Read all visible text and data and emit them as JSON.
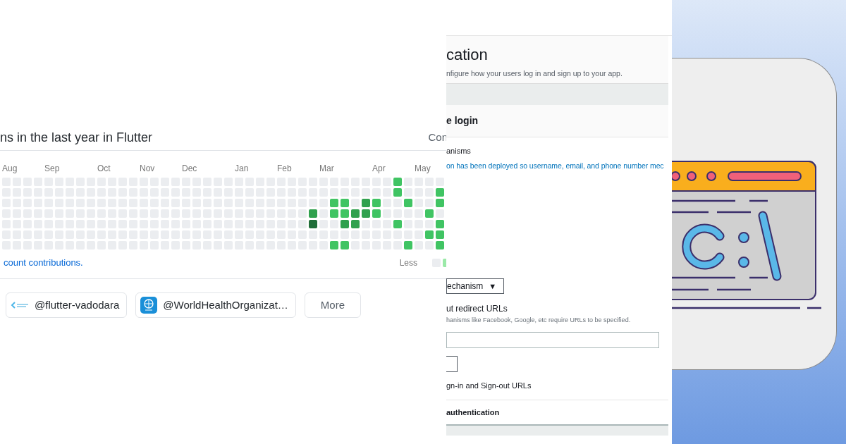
{
  "contributions": {
    "title": "ns in the last year in Flutter",
    "settings_button": "Con",
    "months": [
      "Aug",
      "Sep",
      "Oct",
      "Nov",
      "Dec",
      "Jan",
      "Feb",
      "Mar",
      "Apr",
      "May"
    ],
    "rows": [
      {
        "cells": [
          {
            "color": "#ebedf0"
          },
          {
            "color": "#ebedf0"
          },
          {
            "color": "#ebedf0"
          },
          {
            "color": "#ebedf0"
          },
          {
            "color": "#ebedf0"
          },
          {
            "color": "#ebedf0"
          },
          {
            "color": "#ebedf0"
          },
          {
            "color": "#ebedf0"
          },
          {
            "color": "#ebedf0"
          },
          {
            "color": "#ebedf0"
          },
          {
            "color": "#ebedf0"
          },
          {
            "color": "#ebedf0"
          },
          {
            "color": "#ebedf0"
          },
          {
            "color": "#ebedf0"
          },
          {
            "color": "#ebedf0"
          },
          {
            "color": "#ebedf0"
          },
          {
            "color": "#ebedf0"
          },
          {
            "color": "#ebedf0"
          },
          {
            "color": "#ebedf0"
          },
          {
            "color": "#ebedf0"
          },
          {
            "color": "#ebedf0"
          },
          {
            "color": "#ebedf0"
          },
          {
            "color": "#ebedf0"
          },
          {
            "color": "#ebedf0"
          },
          {
            "color": "#ebedf0"
          },
          {
            "color": "#ebedf0"
          },
          {
            "color": "#ebedf0"
          },
          {
            "color": "#ebedf0"
          },
          {
            "color": "#ebedf0"
          },
          {
            "color": "#ebedf0"
          },
          {
            "color": "#ebedf0"
          },
          {
            "color": "#ebedf0"
          },
          {
            "color": "#ebedf0"
          },
          {
            "color": "#ebedf0"
          },
          {
            "color": "#ebedf0"
          },
          {
            "color": "#ebedf0"
          },
          {
            "color": "#ebedf0"
          },
          {
            "color": "#40c463"
          },
          {
            "color": "#ebedf0"
          },
          {
            "color": "#ebedf0"
          },
          {
            "color": "#ebedf0"
          },
          {
            "color": "#ebedf0"
          }
        ]
      },
      {
        "cells": [
          {
            "color": "#ebedf0"
          },
          {
            "color": "#ebedf0"
          },
          {
            "color": "#ebedf0"
          },
          {
            "color": "#ebedf0"
          },
          {
            "color": "#ebedf0"
          },
          {
            "color": "#ebedf0"
          },
          {
            "color": "#ebedf0"
          },
          {
            "color": "#ebedf0"
          },
          {
            "color": "#ebedf0"
          },
          {
            "color": "#ebedf0"
          },
          {
            "color": "#ebedf0"
          },
          {
            "color": "#ebedf0"
          },
          {
            "color": "#ebedf0"
          },
          {
            "color": "#ebedf0"
          },
          {
            "color": "#ebedf0"
          },
          {
            "color": "#ebedf0"
          },
          {
            "color": "#ebedf0"
          },
          {
            "color": "#ebedf0"
          },
          {
            "color": "#ebedf0"
          },
          {
            "color": "#ebedf0"
          },
          {
            "color": "#ebedf0"
          },
          {
            "color": "#ebedf0"
          },
          {
            "color": "#ebedf0"
          },
          {
            "color": "#ebedf0"
          },
          {
            "color": "#ebedf0"
          },
          {
            "color": "#ebedf0"
          },
          {
            "color": "#ebedf0"
          },
          {
            "color": "#ebedf0"
          },
          {
            "color": "#ebedf0"
          },
          {
            "color": "#ebedf0"
          },
          {
            "color": "#ebedf0"
          },
          {
            "color": "#ebedf0"
          },
          {
            "color": "#ebedf0"
          },
          {
            "color": "#ebedf0"
          },
          {
            "color": "#ebedf0"
          },
          {
            "color": "#ebedf0"
          },
          {
            "color": "#ebedf0"
          },
          {
            "color": "#40c463"
          },
          {
            "color": "#ebedf0"
          },
          {
            "color": "#ebedf0"
          },
          {
            "color": "#ebedf0"
          },
          {
            "color": "#40c463"
          }
        ]
      },
      {
        "cells": [
          {
            "color": "#ebedf0"
          },
          {
            "color": "#ebedf0"
          },
          {
            "color": "#ebedf0"
          },
          {
            "color": "#ebedf0"
          },
          {
            "color": "#ebedf0"
          },
          {
            "color": "#ebedf0"
          },
          {
            "color": "#ebedf0"
          },
          {
            "color": "#ebedf0"
          },
          {
            "color": "#ebedf0"
          },
          {
            "color": "#ebedf0"
          },
          {
            "color": "#ebedf0"
          },
          {
            "color": "#ebedf0"
          },
          {
            "color": "#ebedf0"
          },
          {
            "color": "#ebedf0"
          },
          {
            "color": "#ebedf0"
          },
          {
            "color": "#ebedf0"
          },
          {
            "color": "#ebedf0"
          },
          {
            "color": "#ebedf0"
          },
          {
            "color": "#ebedf0"
          },
          {
            "color": "#ebedf0"
          },
          {
            "color": "#ebedf0"
          },
          {
            "color": "#ebedf0"
          },
          {
            "color": "#ebedf0"
          },
          {
            "color": "#ebedf0"
          },
          {
            "color": "#ebedf0"
          },
          {
            "color": "#ebedf0"
          },
          {
            "color": "#ebedf0"
          },
          {
            "color": "#ebedf0"
          },
          {
            "color": "#ebedf0"
          },
          {
            "color": "#ebedf0"
          },
          {
            "color": "#ebedf0"
          },
          {
            "color": "#40c463"
          },
          {
            "color": "#40c463"
          },
          {
            "color": "#ebedf0"
          },
          {
            "color": "#30a14e"
          },
          {
            "color": "#40c463"
          },
          {
            "color": "#ebedf0"
          },
          {
            "color": "#ebedf0"
          },
          {
            "color": "#40c463"
          },
          {
            "color": "#ebedf0"
          },
          {
            "color": "#ebedf0"
          },
          {
            "color": "#40c463"
          }
        ]
      },
      {
        "cells": [
          {
            "color": "#ebedf0"
          },
          {
            "color": "#ebedf0"
          },
          {
            "color": "#ebedf0"
          },
          {
            "color": "#ebedf0"
          },
          {
            "color": "#ebedf0"
          },
          {
            "color": "#ebedf0"
          },
          {
            "color": "#ebedf0"
          },
          {
            "color": "#ebedf0"
          },
          {
            "color": "#ebedf0"
          },
          {
            "color": "#ebedf0"
          },
          {
            "color": "#ebedf0"
          },
          {
            "color": "#ebedf0"
          },
          {
            "color": "#ebedf0"
          },
          {
            "color": "#ebedf0"
          },
          {
            "color": "#ebedf0"
          },
          {
            "color": "#ebedf0"
          },
          {
            "color": "#ebedf0"
          },
          {
            "color": "#ebedf0"
          },
          {
            "color": "#ebedf0"
          },
          {
            "color": "#ebedf0"
          },
          {
            "color": "#ebedf0"
          },
          {
            "color": "#ebedf0"
          },
          {
            "color": "#ebedf0"
          },
          {
            "color": "#ebedf0"
          },
          {
            "color": "#ebedf0"
          },
          {
            "color": "#ebedf0"
          },
          {
            "color": "#ebedf0"
          },
          {
            "color": "#ebedf0"
          },
          {
            "color": "#ebedf0"
          },
          {
            "color": "#30a14e"
          },
          {
            "color": "#ebedf0"
          },
          {
            "color": "#40c463"
          },
          {
            "color": "#40c463"
          },
          {
            "color": "#30a14e"
          },
          {
            "color": "#30a14e"
          },
          {
            "color": "#40c463"
          },
          {
            "color": "#ebedf0"
          },
          {
            "color": "#ebedf0"
          },
          {
            "color": "#ebedf0"
          },
          {
            "color": "#ebedf0"
          },
          {
            "color": "#40c463"
          },
          {
            "color": "#ebedf0"
          }
        ]
      },
      {
        "cells": [
          {
            "color": "#ebedf0"
          },
          {
            "color": "#ebedf0"
          },
          {
            "color": "#ebedf0"
          },
          {
            "color": "#ebedf0"
          },
          {
            "color": "#ebedf0"
          },
          {
            "color": "#ebedf0"
          },
          {
            "color": "#ebedf0"
          },
          {
            "color": "#ebedf0"
          },
          {
            "color": "#ebedf0"
          },
          {
            "color": "#ebedf0"
          },
          {
            "color": "#ebedf0"
          },
          {
            "color": "#ebedf0"
          },
          {
            "color": "#ebedf0"
          },
          {
            "color": "#ebedf0"
          },
          {
            "color": "#ebedf0"
          },
          {
            "color": "#ebedf0"
          },
          {
            "color": "#ebedf0"
          },
          {
            "color": "#ebedf0"
          },
          {
            "color": "#ebedf0"
          },
          {
            "color": "#ebedf0"
          },
          {
            "color": "#ebedf0"
          },
          {
            "color": "#ebedf0"
          },
          {
            "color": "#ebedf0"
          },
          {
            "color": "#ebedf0"
          },
          {
            "color": "#ebedf0"
          },
          {
            "color": "#ebedf0"
          },
          {
            "color": "#ebedf0"
          },
          {
            "color": "#ebedf0"
          },
          {
            "color": "#ebedf0"
          },
          {
            "color": "#216e39"
          },
          {
            "color": "#ebedf0"
          },
          {
            "color": "#ebedf0"
          },
          {
            "color": "#30a14e"
          },
          {
            "color": "#30a14e"
          },
          {
            "color": "#ebedf0"
          },
          {
            "color": "#ebedf0"
          },
          {
            "color": "#ebedf0"
          },
          {
            "color": "#40c463"
          },
          {
            "color": "#ebedf0"
          },
          {
            "color": "#ebedf0"
          },
          {
            "color": "#ebedf0"
          },
          {
            "color": "#40c463"
          }
        ]
      },
      {
        "cells": [
          {
            "color": "#ebedf0"
          },
          {
            "color": "#ebedf0"
          },
          {
            "color": "#ebedf0"
          },
          {
            "color": "#ebedf0"
          },
          {
            "color": "#ebedf0"
          },
          {
            "color": "#ebedf0"
          },
          {
            "color": "#ebedf0"
          },
          {
            "color": "#ebedf0"
          },
          {
            "color": "#ebedf0"
          },
          {
            "color": "#ebedf0"
          },
          {
            "color": "#ebedf0"
          },
          {
            "color": "#ebedf0"
          },
          {
            "color": "#ebedf0"
          },
          {
            "color": "#ebedf0"
          },
          {
            "color": "#ebedf0"
          },
          {
            "color": "#ebedf0"
          },
          {
            "color": "#ebedf0"
          },
          {
            "color": "#ebedf0"
          },
          {
            "color": "#ebedf0"
          },
          {
            "color": "#ebedf0"
          },
          {
            "color": "#ebedf0"
          },
          {
            "color": "#ebedf0"
          },
          {
            "color": "#ebedf0"
          },
          {
            "color": "#ebedf0"
          },
          {
            "color": "#ebedf0"
          },
          {
            "color": "#ebedf0"
          },
          {
            "color": "#ebedf0"
          },
          {
            "color": "#ebedf0"
          },
          {
            "color": "#ebedf0"
          },
          {
            "color": "#ebedf0"
          },
          {
            "color": "#ebedf0"
          },
          {
            "color": "#ebedf0"
          },
          {
            "color": "#ebedf0"
          },
          {
            "color": "#ebedf0"
          },
          {
            "color": "#ebedf0"
          },
          {
            "color": "#ebedf0"
          },
          {
            "color": "#ebedf0"
          },
          {
            "color": "#ebedf0"
          },
          {
            "color": "#ebedf0"
          },
          {
            "color": "#ebedf0"
          },
          {
            "color": "#40c463"
          },
          {
            "color": "#40c463"
          }
        ]
      },
      {
        "cells": [
          {
            "color": "#ebedf0"
          },
          {
            "color": "#ebedf0"
          },
          {
            "color": "#ebedf0"
          },
          {
            "color": "#ebedf0"
          },
          {
            "color": "#ebedf0"
          },
          {
            "color": "#ebedf0"
          },
          {
            "color": "#ebedf0"
          },
          {
            "color": "#ebedf0"
          },
          {
            "color": "#ebedf0"
          },
          {
            "color": "#ebedf0"
          },
          {
            "color": "#ebedf0"
          },
          {
            "color": "#ebedf0"
          },
          {
            "color": "#ebedf0"
          },
          {
            "color": "#ebedf0"
          },
          {
            "color": "#ebedf0"
          },
          {
            "color": "#ebedf0"
          },
          {
            "color": "#ebedf0"
          },
          {
            "color": "#ebedf0"
          },
          {
            "color": "#ebedf0"
          },
          {
            "color": "#ebedf0"
          },
          {
            "color": "#ebedf0"
          },
          {
            "color": "#ebedf0"
          },
          {
            "color": "#ebedf0"
          },
          {
            "color": "#ebedf0"
          },
          {
            "color": "#ebedf0"
          },
          {
            "color": "#ebedf0"
          },
          {
            "color": "#ebedf0"
          },
          {
            "color": "#ebedf0"
          },
          {
            "color": "#ebedf0"
          },
          {
            "color": "#ebedf0"
          },
          {
            "color": "#ebedf0"
          },
          {
            "color": "#40c463"
          },
          {
            "color": "#40c463"
          },
          {
            "color": "#ebedf0"
          },
          {
            "color": "#ebedf0"
          },
          {
            "color": "#ebedf0"
          },
          {
            "color": "#ebedf0"
          },
          {
            "color": "#ebedf0"
          },
          {
            "color": "#40c463"
          },
          {
            "color": "#ebedf0"
          },
          {
            "color": "#ebedf0"
          },
          {
            "color": "#40c463"
          }
        ]
      }
    ],
    "footer_link": "count contributions.",
    "legend_label": "Less",
    "legend": [
      {
        "color": "#ebedf0"
      },
      {
        "color": "#9be9a8"
      }
    ]
  },
  "organizations": [
    {
      "kind": "chevron",
      "label": "@flutter-vadodara"
    },
    {
      "kind": "globe",
      "label": "@WorldHealthOrganizat…"
    },
    {
      "kind": "more",
      "label": "More"
    }
  ],
  "auth_panel": {
    "heading": "cation",
    "subtitle": "nfigure how your users log in and sign up to your app.",
    "section_title": "e login",
    "mechanisms_label": "anisms",
    "notice": "on has been deployed so username, email, and phone number mec",
    "dropdown": "echanism",
    "dropdown_caret": "▼",
    "redirect_label": "ut redirect URLs",
    "redirect_hint": "hanisms like Facebook, Google, etc require URLs to be specified.",
    "urls_label": "gn-in and Sign-out URLs",
    "next_section": "authentication"
  }
}
